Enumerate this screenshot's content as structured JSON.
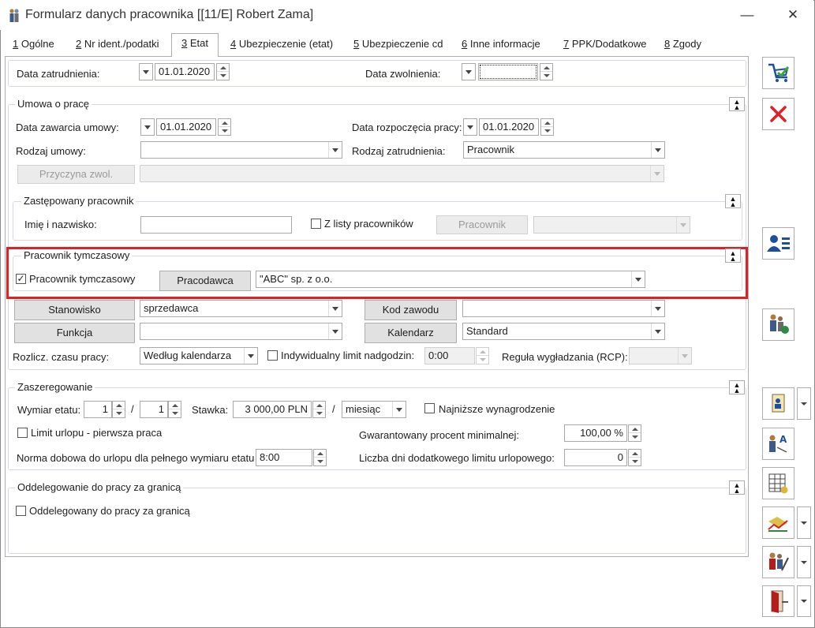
{
  "window": {
    "title": "Formularz danych pracownika [[11/E] Robert Zama]",
    "minimize_glyph": "—",
    "close_glyph": "✕"
  },
  "tabs": [
    {
      "key": "1",
      "label": " Ogólne"
    },
    {
      "key": "2",
      "label": " Nr ident./podatki"
    },
    {
      "key": "3",
      "label": " Etat"
    },
    {
      "key": "4",
      "label": " Ubezpieczenie (etat)"
    },
    {
      "key": "5",
      "label": " Ubezpieczenie cd"
    },
    {
      "key": "6",
      "label": " Inne informacje"
    },
    {
      "key": "7",
      "label": " PPK/Dodatkowe"
    },
    {
      "key": "8",
      "label": " Zgody"
    }
  ],
  "employment": {
    "hire_date_label": "Data zatrudnienia:",
    "hire_date": "01.01.2020",
    "release_date_label": "Data zwolnienia:",
    "release_date": ""
  },
  "contract": {
    "legend": "Umowa o pracę",
    "conclusion_label": "Data zawarcia umowy:",
    "conclusion_date": "01.01.2020",
    "start_label": "Data rozpoczęcia pracy:",
    "start_date": "01.01.2020",
    "type_label": "Rodzaj umowy:",
    "type_value": "",
    "employment_type_label": "Rodzaj zatrudnienia:",
    "employment_type_value": "Pracownik",
    "reason_button": "Przyczyna zwol.",
    "reason_value": ""
  },
  "substitute": {
    "legend": "Zastępowany pracownik",
    "name_label": "Imię i nazwisko:",
    "name_value": "",
    "from_list_label": "Z listy pracowników",
    "employee_button": "Pracownik",
    "employee_value": ""
  },
  "temp": {
    "legend": "Pracownik tymczasowy",
    "checkbox_label": "Pracownik tymczasowy",
    "checked": true,
    "employer_button": "Pracodawca",
    "employer_value": "\"ABC\" sp. z o.o."
  },
  "position": {
    "position_button": "Stanowisko",
    "position_value": "sprzedawca",
    "code_button": "Kod zawodu",
    "code_value": "",
    "function_button": "Funkcja",
    "function_value": "",
    "calendar_button": "Kalendarz",
    "calendar_value": "Standard",
    "settlement_label": "Rozlicz. czasu pracy:",
    "settlement_value": "Według kalendarza",
    "overtime_label": "Indywidualny limit nadgodzin:",
    "overtime_value": "0:00",
    "rcp_label": "Reguła wygładzania (RCP):",
    "rcp_value": ""
  },
  "grading": {
    "legend": "Zaszeregowanie",
    "fte_label": "Wymiar etatu:",
    "fte_numerator": "1",
    "fte_sep": "/",
    "fte_denominator": "1",
    "rate_label": "Stawka:",
    "rate_value": "3 000,00 PLN",
    "rate_sep": "/",
    "period_value": "miesiąc",
    "min_wage_label": "Najniższe wynagrodzenie",
    "leave_limit_label": "Limit urlopu - pierwsza praca",
    "guaranteed_label": "Gwarantowany procent minimalnej:",
    "guaranteed_value": "100,00 %",
    "norm_label": "Norma dobowa do urlopu dla pełnego wymiaru etatu",
    "norm_value": "8:00",
    "extra_days_label": "Liczba dni dodatkowego limitu urlopowego:",
    "extra_days_value": "0"
  },
  "abroad": {
    "legend": "Oddelegowanie do pracy za granicą",
    "checkbox_label": "Oddelegowany do pracy za granicą"
  },
  "sidebar": {
    "save_icon": "save-icon",
    "cancel_icon": "close-icon"
  },
  "colors": {
    "highlight": "#e31e24",
    "accent": "#1f4e9c"
  }
}
